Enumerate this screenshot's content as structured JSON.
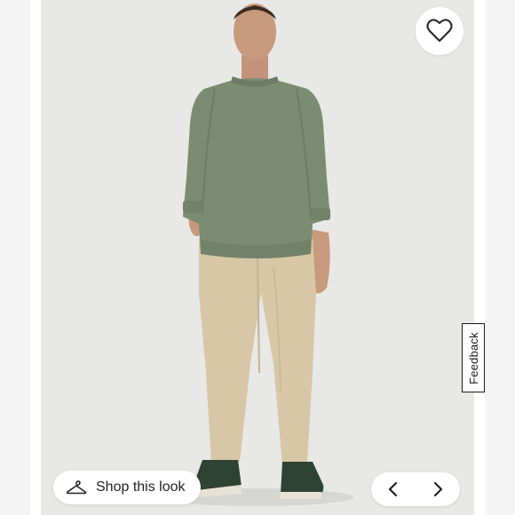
{
  "image": {
    "alt": "Model wearing a sage green crewneck sweatshirt with khaki pants and green sneakers"
  },
  "favorite": {
    "icon": "heart-outline-icon"
  },
  "feedback": {
    "label": "Feedback"
  },
  "shop_look": {
    "label": "Shop this look",
    "icon": "hanger-icon"
  },
  "carousel": {
    "prev_icon": "chevron-left-icon",
    "next_icon": "chevron-right-icon"
  },
  "colors": {
    "background": "#e8e8e6",
    "sweatshirt": "#7b8c72",
    "pants": "#d7c7a6",
    "skin": "#c79a7d",
    "shoes": "#2f4334"
  }
}
